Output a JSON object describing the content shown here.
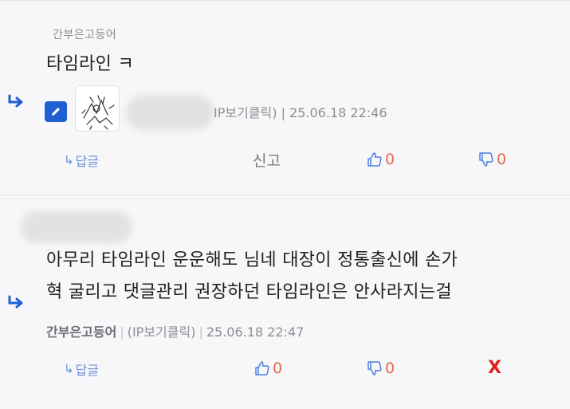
{
  "comments": [
    {
      "prev_author": "간부은고등어",
      "body": "타임라인 ㅋ",
      "meta": "IP보기클릭) | 25.06.18 22:46",
      "actions": {
        "reply": "답글",
        "report": "신고",
        "like_count": "0",
        "dislike_count": "0"
      }
    },
    {
      "body_line1": "아무리 타임라인 운운해도 님네 대장이 정통출신에 손가",
      "body_line2": "혁 굴리고 댓글관리 권장하던 타임라인은 안사라지는걸",
      "nick": "간부은고등어",
      "meta_rest": "(IP보기클릭)",
      "date": "25.06.18 22:47",
      "actions": {
        "reply": "답글",
        "like_count": "0",
        "dislike_count": "0",
        "delete": "X"
      }
    }
  ],
  "colors": {
    "accent": "#1f5fd4",
    "count": "#e46b4a",
    "delete": "#e2201a",
    "link": "#6a8fd8"
  },
  "icons": [
    "reply-arrow-icon",
    "edit-icon",
    "thumbs-up-icon",
    "thumbs-down-icon"
  ]
}
